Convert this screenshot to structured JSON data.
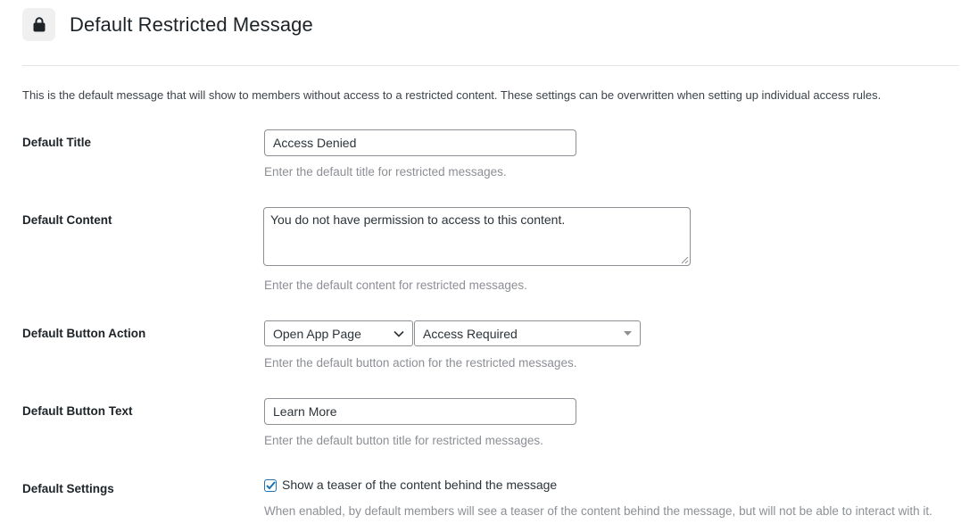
{
  "header": {
    "title": "Default Restricted Message",
    "icon": "lock-icon"
  },
  "intro": "This is the default message that will show to members without access to a restricted content. These settings can be overwritten when setting up individual access rules.",
  "fields": {
    "title": {
      "label": "Default Title",
      "value": "Access Denied",
      "help": "Enter the default title for restricted messages."
    },
    "content": {
      "label": "Default Content",
      "value": "You do not have permission to access to this content.",
      "help": "Enter the default content for restricted messages."
    },
    "button_action": {
      "label": "Default Button Action",
      "action_value": "Open App Page",
      "page_value": "Access Required",
      "help": "Enter the default button action for the restricted messages."
    },
    "button_text": {
      "label": "Default Button Text",
      "value": "Learn More",
      "help": "Enter the default button title for restricted messages."
    },
    "settings": {
      "label": "Default Settings",
      "checkbox_label": "Show a teaser of the content behind the message",
      "checked": true,
      "help": "When enabled, by default members will see a teaser of the content behind the message, but will not be able to interact with it."
    }
  },
  "colors": {
    "accent": "#2271b1",
    "help_text": "#8c8f94",
    "border": "#8c8f94"
  }
}
